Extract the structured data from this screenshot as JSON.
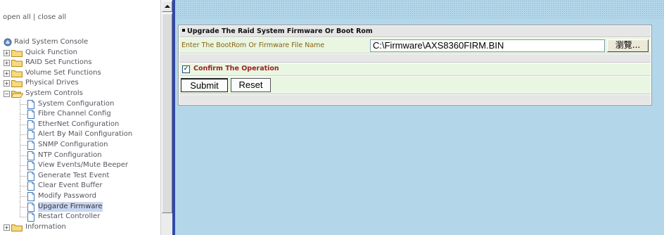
{
  "left_nav": {
    "open_all": "open all",
    "separator": "|",
    "close_all": "close all",
    "root": "Raid System Console",
    "items": [
      {
        "label": "Quick Function",
        "type": "folder"
      },
      {
        "label": "RAID Set Functions",
        "type": "folder"
      },
      {
        "label": "Volume Set Functions",
        "type": "folder"
      },
      {
        "label": "Physical Drives",
        "type": "folder"
      },
      {
        "label": "System Controls",
        "type": "folder-open"
      },
      {
        "label": "System Configuration",
        "type": "page"
      },
      {
        "label": "Fibre Channel Config",
        "type": "page"
      },
      {
        "label": "EtherNet Configuration",
        "type": "page"
      },
      {
        "label": "Alert By Mail Configuration",
        "type": "page"
      },
      {
        "label": "SNMP Configuration",
        "type": "page"
      },
      {
        "label": "NTP Configuration",
        "type": "page"
      },
      {
        "label": "View Events/Mute Beeper",
        "type": "page"
      },
      {
        "label": "Generate Test Event",
        "type": "page"
      },
      {
        "label": "Clear Event Buffer",
        "type": "page"
      },
      {
        "label": "Modify Password",
        "type": "page"
      },
      {
        "label": "Upgarde Firmware",
        "type": "page",
        "selected": true
      },
      {
        "label": "Restart Controller",
        "type": "page"
      },
      {
        "label": "Information",
        "type": "folder"
      }
    ]
  },
  "form": {
    "title": "Upgrade The Raid System Firmware Or Boot Rom",
    "file_label": "Enter The BootRom Or Firmware File Name",
    "file_value": "C:\\Firmware\\AXS8360FIRM.BIN",
    "browse_label": "瀏覽...",
    "confirm_checked": true,
    "confirm_label": "Confirm The Operation",
    "submit_label": "Submit",
    "reset_label": "Reset"
  },
  "colors": {
    "frame_border": "#3049a8",
    "background": "#b4d6e9",
    "row_green": "#e9f6e2",
    "label_brown": "#8a6010",
    "confirm_red": "#a02020"
  }
}
